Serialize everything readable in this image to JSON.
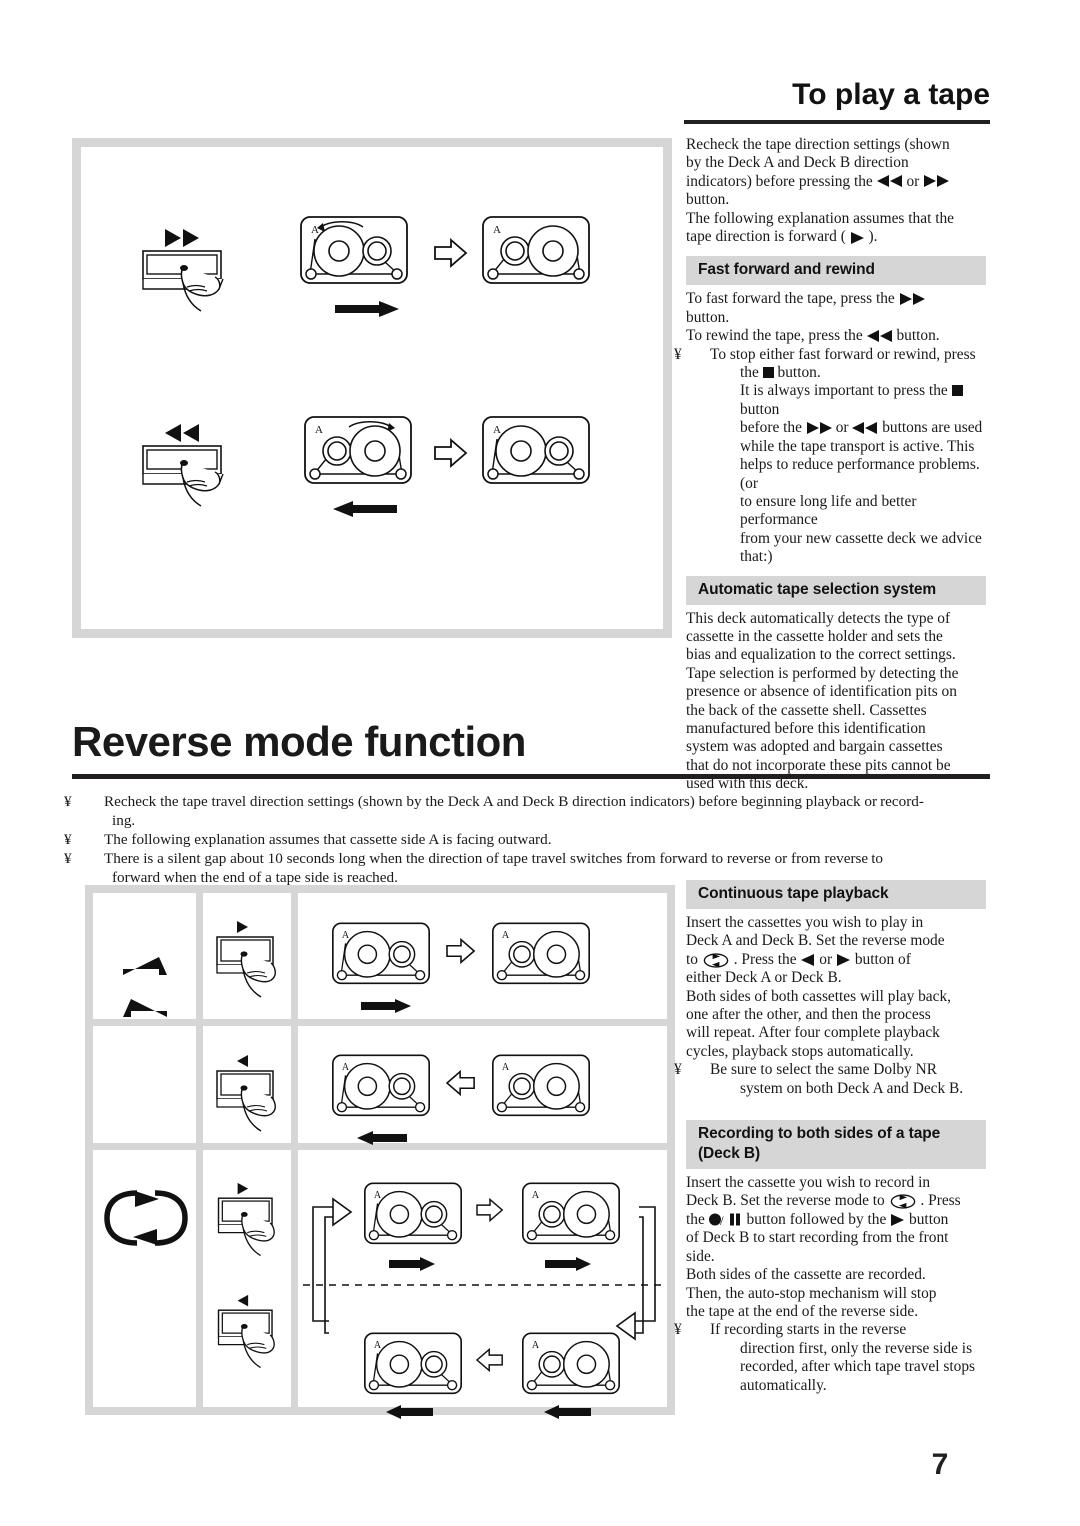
{
  "page": {
    "number": "7"
  },
  "play_section": {
    "title": "To play a tape",
    "intro": "Recheck the tape direction settings (shown by the Deck A and Deck B direction indicators) before pressing the ◄◄ or ►► button.",
    "intro_lines": [
      "Recheck the tape direction settings (shown",
      "by the Deck A and Deck B direction",
      "indicators) before pressing the",
      "button.",
      "The following explanation assumes that the",
      "tape direction is forward (      )."
    ],
    "ff_heading": "Fast forward and rewind",
    "ff_lines": [
      "To fast forward the tape, press the",
      "button.",
      "To rewind the tape, press the            button."
    ],
    "ff_note": "To stop either fast forward or rewind, press the ■ button. It is always important to press the ■ button before the ►► or ◄◄ buttons are used while the tape transport is active. This helps to reduce performance problems. (or to ensure long life and better performance from your new cassette deck we advice that:)",
    "ff_note_lines": [
      "To stop either fast forward or rewind, press",
      "the        button.",
      "It is always important to press the        button",
      "before the            or            buttons are used",
      "while the tape transport is active. This",
      "helps to reduce performance problems. (or",
      "to ensure long life and better performance",
      "from your new cassette deck we advice",
      "that:)"
    ],
    "auto_heading": "Automatic tape selection system",
    "auto_text": "This deck automatically detects the type of cassette in the cassette holder and sets the bias and equalization to the correct settings. Tape selection is performed by detecting the presence or absence of identification pits on the back of the cassette shell. Cassettes manufactured before this identification system was adopted and bargain cassettes that do not incorporate these pits cannot be used with this deck.",
    "auto_lines": [
      "This deck automatically detects the type of",
      "cassette in the cassette holder and sets the",
      "bias and equalization to the correct settings.",
      "Tape selection is performed by detecting the",
      "presence or absence of identification pits on",
      "the back of the cassette shell. Cassettes",
      "manufactured before this identification",
      "system was adopted and bargain cassettes",
      "that do not incorporate these pits cannot be",
      "used with this deck."
    ]
  },
  "play_figure": {
    "rows": [
      {
        "button_label": "fast-forward-button",
        "cassette_before": "reel-left-large",
        "cassette_after": "reel-right-large",
        "travel": "right"
      },
      {
        "button_label": "rewind-button",
        "cassette_before": "reel-right-large",
        "cassette_after": "reel-left-large",
        "travel": "left"
      }
    ],
    "cassette_side_label": "A"
  },
  "reverse_section": {
    "title": "Reverse mode function",
    "notes": [
      "Recheck the tape travel direction settings (shown by the Deck A and Deck B direction indicators) before beginning playback or recording.",
      "The following explanation assumes that cassette side A is facing outward.",
      "There is a silent gap about 10 seconds long when the direction of tape travel switches from forward to reverse or from reverse to forward when the end of a tape side is reached."
    ],
    "note_lines": [
      [
        "Recheck the tape travel direction settings (shown by the Deck A and Deck B direction indicators) before beginning playback or record-",
        "ing."
      ],
      [
        "The following explanation assumes that cassette side A is facing outward."
      ],
      [
        "There is a silent gap about 10 seconds long when the direction of tape travel switches from forward to reverse or from reverse to",
        "forward when the end of a tape side is reached."
      ]
    ],
    "bullet": "¥",
    "cassette_side_label": "A"
  },
  "reverse_table": {
    "rows": [
      {
        "mode_icon": "reverse-mode-forward-icon",
        "button_icon": "play-forward-button",
        "travel": "right"
      },
      {
        "mode_icon": "reverse-mode-reverse-icon",
        "button_icon": "play-reverse-button",
        "travel": "left"
      },
      {
        "mode_icon": "reverse-mode-loop-icon",
        "button_icon": "play-both-buttons",
        "travel": "cycle"
      }
    ]
  },
  "continuous_section": {
    "heading": "Continuous tape playback",
    "text": "Insert the cassettes you wish to play in Deck A and Deck B. Set the reverse mode to (loop). Press the ◄ or ► button of either Deck A or Deck B. Both sides of both cassettes will play back, one after the other, and then the process will repeat. After four complete playback cycles, playback stops automatically.",
    "lines": [
      "Insert the cassettes you wish to play in",
      "Deck A and Deck B. Set the reverse mode",
      "to          . Press the        or        button of",
      "either Deck A or Deck B.",
      "Both sides of both cassettes will play back,",
      "one after the other, and then the process",
      "will repeat. After four complete playback",
      "cycles, playback stops automatically."
    ],
    "note": "Be sure to select the same Dolby NR system on both Deck A and Deck B.",
    "note_lines": [
      "Be sure to select the same Dolby NR",
      "system on both Deck A and Deck B."
    ]
  },
  "recording_section": {
    "heading_line1": "Recording to both sides of a tape",
    "heading_line2": "(Deck B)",
    "text": "Insert the cassette you wish to record in Deck B. Set the reverse mode to (loop). Press the ●/II button followed by the ► button of Deck B to start recording from the front side. Both sides of the cassette are recorded. Then, the auto-stop mechanism will stop the tape at the end of the reverse side.",
    "lines": [
      "Insert the cassette you wish to record in",
      "Deck B. Set the reverse mode to          . Press",
      "the            button followed by the        button",
      "of Deck B to start recording from the front",
      "side.",
      "Both sides of the cassette are recorded.",
      "Then, the auto-stop mechanism will stop",
      "the tape at the end of the reverse side."
    ],
    "note": "If recording starts in the reverse direction first, only the reverse side is recorded, after which tape travel stops automatically.",
    "note_lines": [
      "If recording starts in the reverse",
      "direction first, only the reverse side is",
      "recorded, after which tape travel stops",
      "automatically."
    ]
  },
  "colors": {
    "panel_border": "#d6d6d6",
    "section_header_bg": "#d6d6d6",
    "text": "#1a1a1a",
    "rule": "#231f20"
  }
}
